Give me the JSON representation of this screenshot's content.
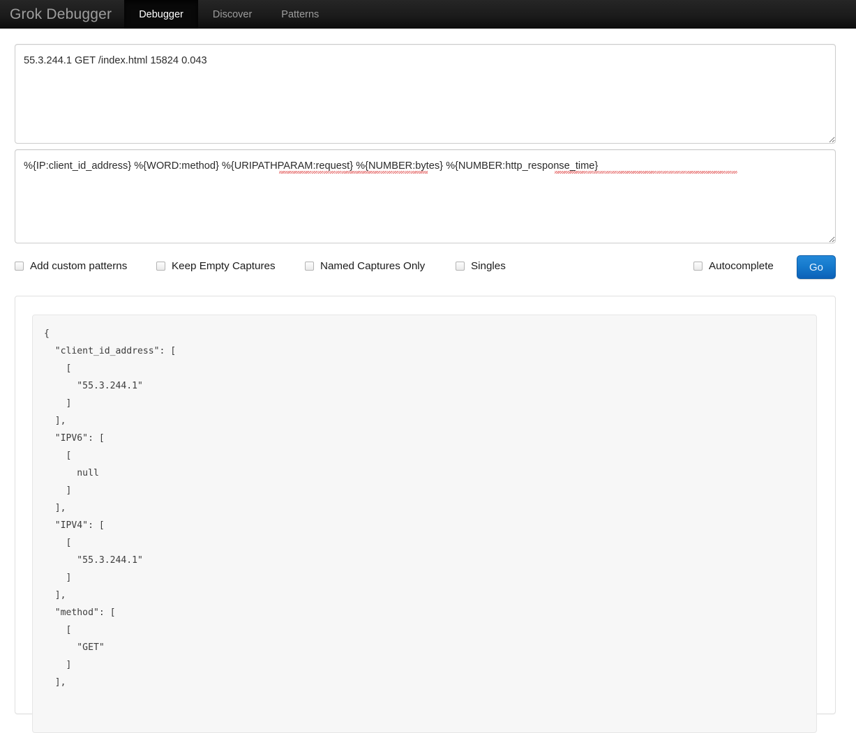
{
  "navbar": {
    "brand": "Grok Debugger",
    "tabs": [
      {
        "label": "Debugger",
        "active": true
      },
      {
        "label": "Discover",
        "active": false
      },
      {
        "label": "Patterns",
        "active": false
      }
    ]
  },
  "input": {
    "value": "55.3.244.1 GET /index.html 15824 0.043",
    "placeholder": "Input"
  },
  "pattern": {
    "value": "%{IP:client_id_address} %{WORD:method} %{URIPATHPARAM:request} %{NUMBER:bytes} %{NUMBER:http_response_time}",
    "placeholder": "Pattern"
  },
  "options": {
    "checkboxes": [
      {
        "label": "Add custom patterns",
        "checked": false
      },
      {
        "label": "Keep Empty Captures",
        "checked": false
      },
      {
        "label": "Named Captures Only",
        "checked": false
      },
      {
        "label": "Singles",
        "checked": false
      },
      {
        "label": "Autocomplete",
        "checked": false
      }
    ],
    "go_label": "Go"
  },
  "result": {
    "text": "{\n  \"client_id_address\": [\n    [\n      \"55.3.244.1\"\n    ]\n  ],\n  \"IPV6\": [\n    [\n      null\n    ]\n  ],\n  \"IPV4\": [\n    [\n      \"55.3.244.1\"\n    ]\n  ],\n  \"method\": [\n    [\n      \"GET\"\n    ]\n  ],"
  },
  "colors": {
    "navbar_bg": "#1b1b1b",
    "navbar_active_bg": "#090909",
    "go_button": "#1579cc",
    "result_bg": "#f7f7f7",
    "spellcheck_underline": "#e04a4a"
  }
}
